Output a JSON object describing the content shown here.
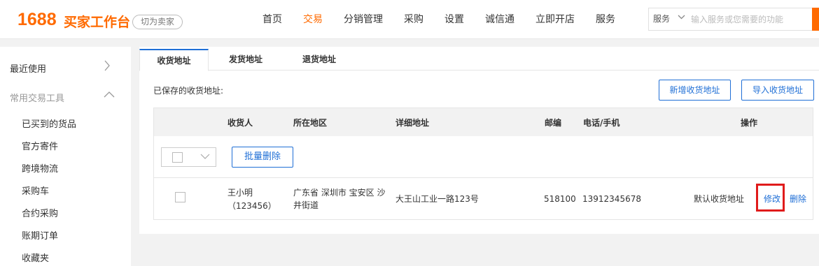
{
  "header": {
    "logo_num": "1688",
    "logo_text": "买家工作台",
    "switch_label": "切为卖家",
    "nav": [
      "首页",
      "交易",
      "分销管理",
      "采购",
      "设置",
      "诚信通",
      "立即开店",
      "服务"
    ],
    "active_nav": "交易",
    "search_category": "服务",
    "search_placeholder": "输入服务或您需要的功能"
  },
  "sidebar": {
    "recent": "最近使用",
    "tools": "常用交易工具",
    "items": [
      "已买到的货品",
      "官方寄件",
      "跨境物流",
      "采购车",
      "合约采购",
      "账期订单",
      "收藏夹"
    ]
  },
  "tabs": [
    "收货地址",
    "发货地址",
    "退货地址"
  ],
  "saved_label": "已保存的收货地址:",
  "buttons": {
    "add": "新增收货地址",
    "import": "导入收货地址",
    "batch_delete": "批量删除"
  },
  "table": {
    "headers": [
      "收货人",
      "所在地区",
      "详细地址",
      "邮编",
      "电话/手机",
      "操作"
    ],
    "row": {
      "name": "王小明",
      "code": "（123456）",
      "region_line1": "广东省 深圳市 宝安区 沙",
      "region_line2": "井街道",
      "address": "大王山工业一路123号",
      "zip": "518100",
      "phone": "13912345678",
      "default_label": "默认收货地址",
      "edit": "修改",
      "delete": "删除"
    }
  },
  "colors": {
    "brand": "#ff6a00",
    "link": "#1f6fd6",
    "highlight": "#e01b1b"
  }
}
